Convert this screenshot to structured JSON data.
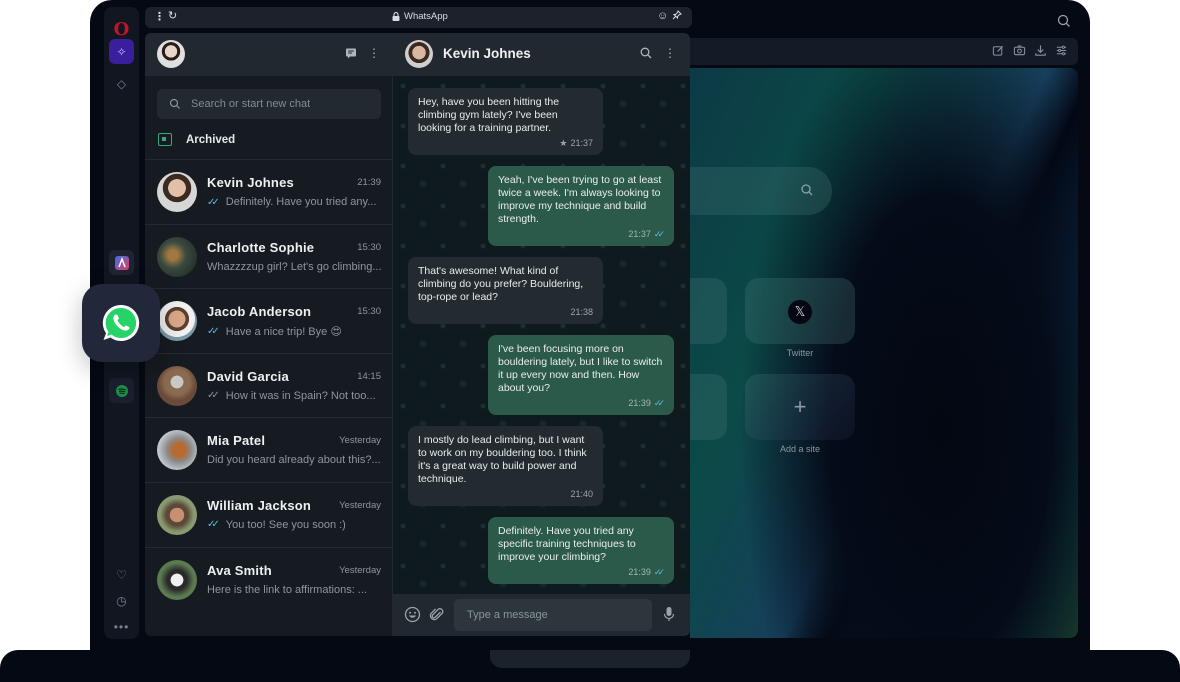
{
  "browser": {
    "sidebar": {
      "items": [
        {
          "name": "opera-logo",
          "glyph": "O"
        },
        {
          "name": "aria",
          "glyph": "✧"
        },
        {
          "name": "crypto-wallet",
          "glyph": "◇"
        },
        {
          "name": "app",
          "glyph": "◭"
        },
        {
          "name": "spotify",
          "glyph": "≋"
        },
        {
          "name": "bookmarks",
          "glyph": "♡"
        },
        {
          "name": "history",
          "glyph": "◷"
        },
        {
          "name": "more",
          "glyph": "•••"
        }
      ]
    },
    "toolbar_icons": [
      "snapshot-edit-icon",
      "camera-icon",
      "download-icon",
      "easy-setup-icon"
    ],
    "start_page": {
      "speed_dials": [
        {
          "label": "Twitter",
          "icon": "x-logo",
          "glyph": "𝕏"
        },
        {
          "label": "Add a site",
          "icon": "plus",
          "glyph": "+"
        }
      ]
    }
  },
  "popup": {
    "title": "WhatsApp",
    "more_glyph": "⋮",
    "reload_glyph": "↻",
    "emoji_glyph": "☺",
    "pin_glyph": "📌"
  },
  "whatsapp": {
    "search": {
      "placeholder": "Search or start new chat"
    },
    "archived_label": "Archived",
    "chats": [
      {
        "name": "Kevin Johnes",
        "time": "21:39",
        "preview": "Definitely. Have you tried any...",
        "ticks": "read"
      },
      {
        "name": "Charlotte Sophie",
        "time": "15:30",
        "preview": "Whazzzzup girl? Let's go climbing...",
        "ticks": "none"
      },
      {
        "name": "Jacob Anderson",
        "time": "15:30",
        "preview": "Have a nice trip! Bye 😍",
        "ticks": "read"
      },
      {
        "name": "David Garcia",
        "time": "14:15",
        "preview": "How it was in Spain? Not too...",
        "ticks": "sent"
      },
      {
        "name": "Mia Patel",
        "time": "Yesterday",
        "preview": "Did you heard already about this?...",
        "ticks": "none"
      },
      {
        "name": "William Jackson",
        "time": "Yesterday",
        "preview": "You too! See you soon :)",
        "ticks": "read"
      },
      {
        "name": "Ava Smith",
        "time": "Yesterday",
        "preview": "Here is the link to affirmations: ...",
        "ticks": "none"
      }
    ],
    "conversation": {
      "contact_name": "Kevin Johnes",
      "messages": [
        {
          "direction": "in",
          "text": "Hey, have you been hitting the climbing gym lately? I've been looking for a training partner.",
          "time": "21:37",
          "starred": true
        },
        {
          "direction": "out",
          "text": "Yeah, I've been trying to go at least twice a week. I'm always looking to improve my technique and build strength.",
          "time": "21:37",
          "ticks": "read"
        },
        {
          "direction": "in",
          "text": "That's awesome! What kind of climbing do you prefer? Bouldering, top-rope or lead?",
          "time": "21:38"
        },
        {
          "direction": "out",
          "text": "I've been focusing more on bouldering lately, but I like to switch it up every now and then. How about you?",
          "time": "21:39",
          "ticks": "read"
        },
        {
          "direction": "in",
          "text": "I mostly do lead climbing, but I want to work on my bouldering too. I think it's a great way to build power and technique.",
          "time": "21:40"
        },
        {
          "direction": "out",
          "text": "Definitely. Have you tried any specific training techniques to improve your climbing?",
          "time": "21:39",
          "ticks": "read"
        }
      ],
      "composer_placeholder": "Type a message"
    },
    "colors": {
      "accent_green": "#25d366",
      "read_tick": "#53bdeb",
      "outgoing_bubble": "#2c5a4a",
      "incoming_bubble": "#232a30"
    }
  }
}
